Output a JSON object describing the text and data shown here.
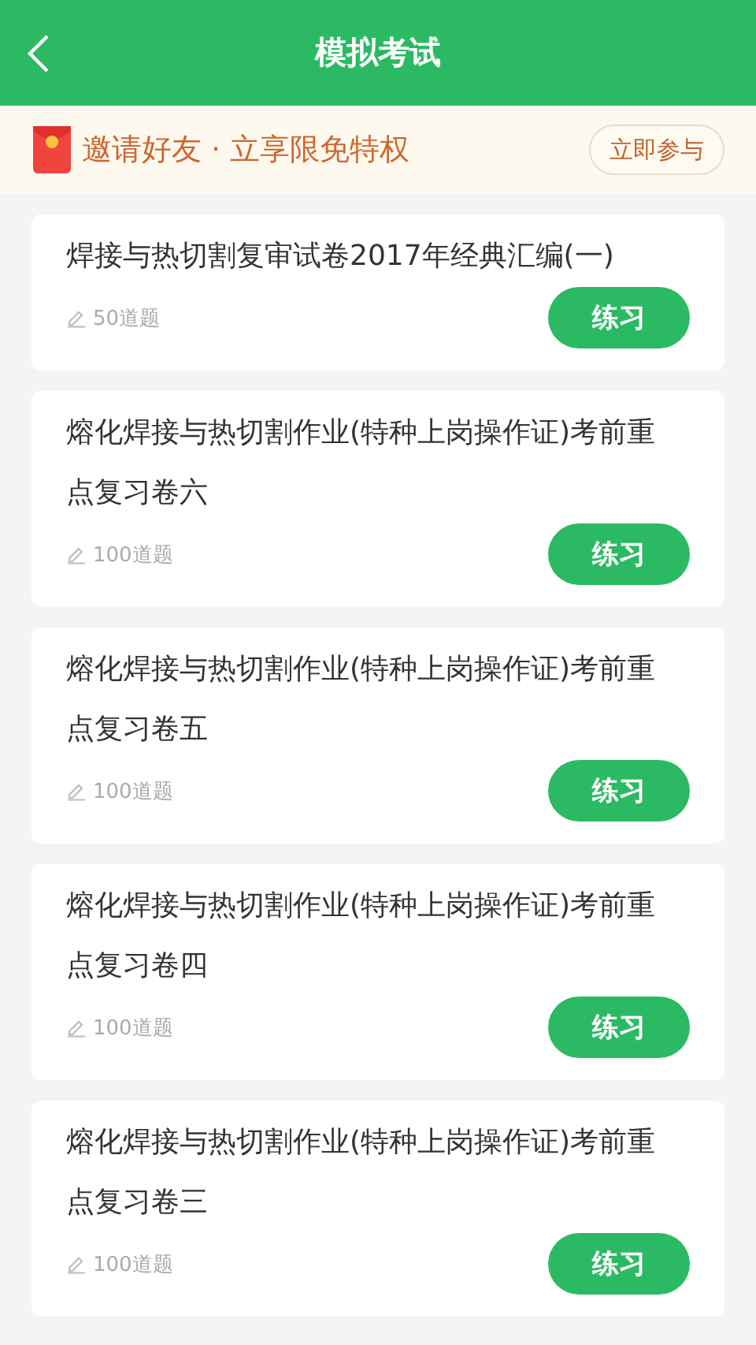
{
  "header": {
    "title": "模拟考试"
  },
  "banner": {
    "text": "邀请好友 · 立享限免特权",
    "button": "立即参与"
  },
  "exams": [
    {
      "title": "焊接与热切割复审试卷2017年经典汇编(一)",
      "count": "50道题",
      "button": "练习"
    },
    {
      "title": "熔化焊接与热切割作业(特种上岗操作证)考前重点复习卷六",
      "count": "100道题",
      "button": "练习"
    },
    {
      "title": "熔化焊接与热切割作业(特种上岗操作证)考前重点复习卷五",
      "count": "100道题",
      "button": "练习"
    },
    {
      "title": "熔化焊接与热切割作业(特种上岗操作证)考前重点复习卷四",
      "count": "100道题",
      "button": "练习"
    },
    {
      "title": "熔化焊接与热切割作业(特种上岗操作证)考前重点复习卷三",
      "count": "100道题",
      "button": "练习"
    }
  ]
}
